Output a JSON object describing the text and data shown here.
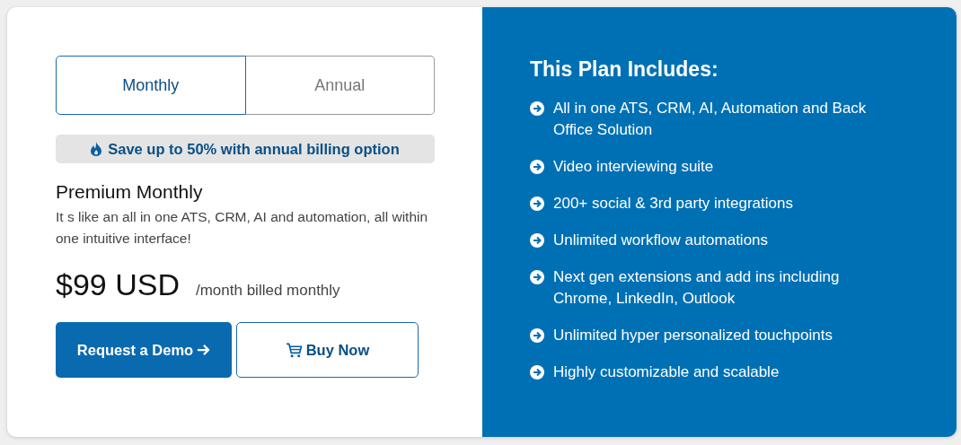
{
  "billing_tabs": [
    {
      "label": "Monthly",
      "selected": true
    },
    {
      "label": "Annual",
      "selected": false
    }
  ],
  "savings_banner": "Save up to 50% with annual billing option",
  "plan": {
    "name": "Premium Monthly",
    "description": "It s like an all in one ATS, CRM, AI and automation, all within one intuitive interface!",
    "price": "$99 USD",
    "period": "/month billed monthly"
  },
  "buttons": [
    {
      "label": "Request a Demo",
      "kind": "primary"
    },
    {
      "label": "Buy Now",
      "kind": "cart"
    }
  ],
  "features": {
    "heading": "This Plan Includes:",
    "items": [
      "All in one ATS, CRM, AI, Automation and Back Office Solution",
      "Video interviewing suite",
      "200+ social & 3rd party integrations",
      "Unlimited workflow automations",
      "Next gen extensions and add ins including Chrome, LinkedIn, Outlook",
      "Unlimited hyper personalized touchpoints",
      "Highly customizable and scalable"
    ]
  }
}
